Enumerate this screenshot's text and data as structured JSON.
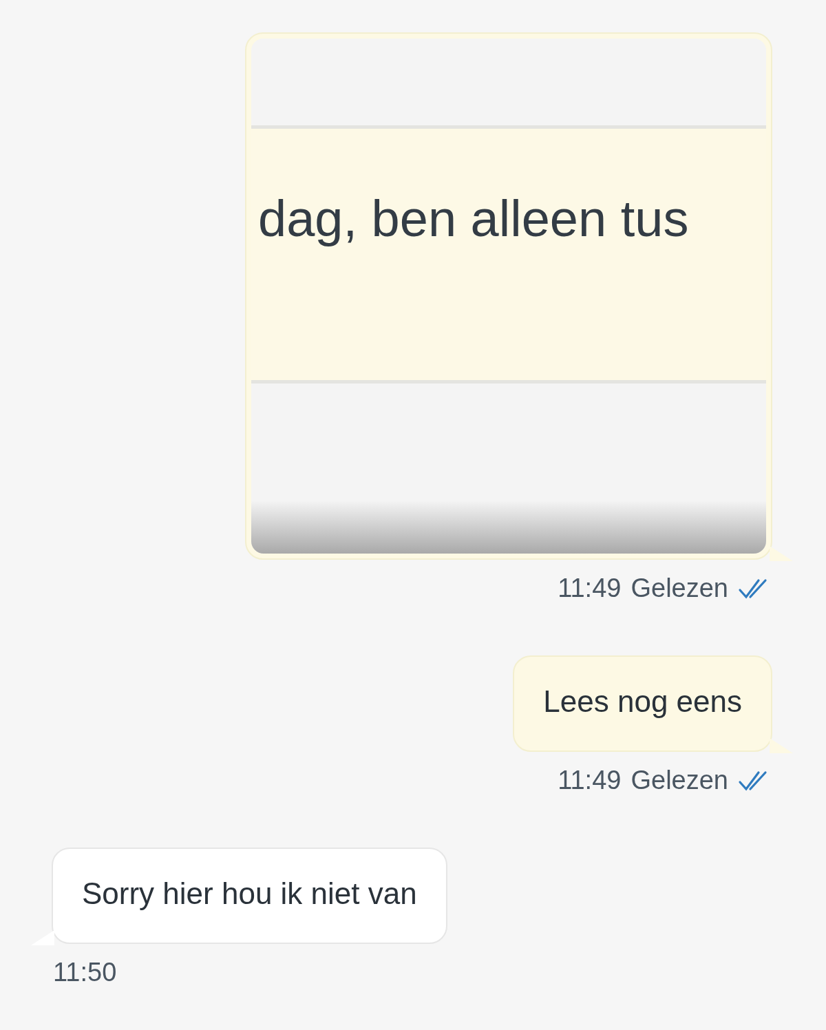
{
  "messages": [
    {
      "kind": "image",
      "outgoing": true,
      "embedded_text": "dag, ben alleen tus",
      "time": "11:49",
      "status": "Gelezen",
      "read": true
    },
    {
      "kind": "text",
      "outgoing": true,
      "text": "Lees nog eens",
      "time": "11:49",
      "status": "Gelezen",
      "read": true
    },
    {
      "kind": "text",
      "outgoing": false,
      "text": "Sorry hier hou ik niet van",
      "time": "11:50"
    }
  ]
}
